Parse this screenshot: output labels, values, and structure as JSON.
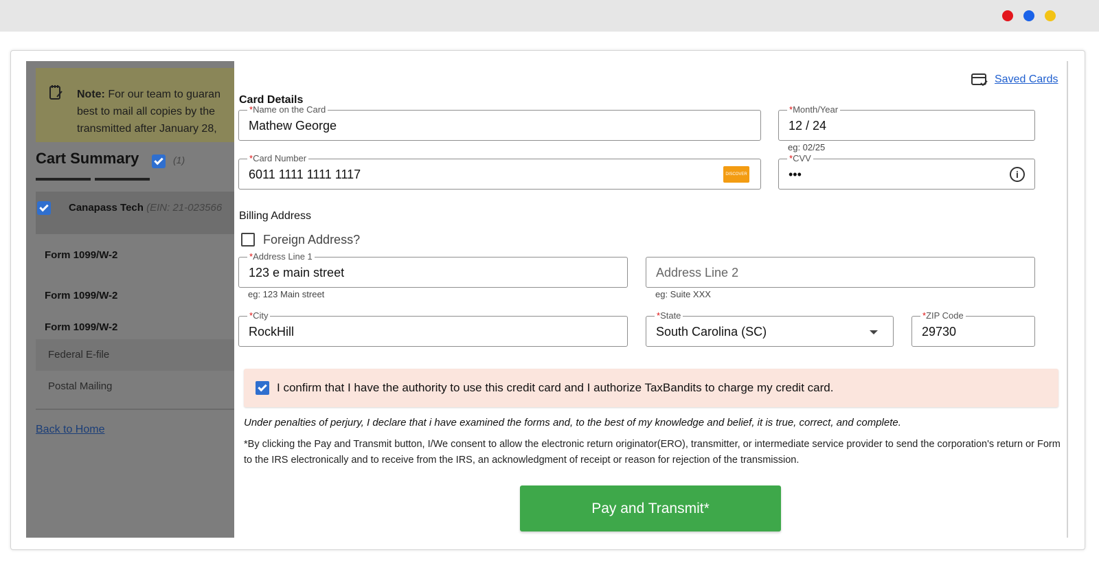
{
  "window": {
    "dots": [
      "#e3161d",
      "#1a62e8",
      "#f3c315"
    ]
  },
  "left": {
    "note": {
      "bold": "Note:",
      "line1": " For our team to guaran",
      "line2": "best to mail all copies by the ",
      "line3": "transmitted after January 28,"
    },
    "cart_title": "Cart Summary",
    "cart_count": "(1)",
    "company_name": "Canapass Tech",
    "company_ein": "(EIN:  21-023566",
    "forms": [
      "Form 1099/W-2",
      "Form 1099/W-2",
      "Form 1099/W-2"
    ],
    "services": [
      "Federal E-file",
      "Postal Mailing"
    ],
    "back_home": "Back to Home"
  },
  "payment": {
    "saved_cards": "Saved Cards",
    "card_details_title": "Card Details",
    "name_label": "Name on the Card",
    "name_value": "Mathew George",
    "month_label": "Month/Year",
    "month_value": "12 / 24",
    "month_hint": "eg: 02/25",
    "card_number_label": "Card Number",
    "card_number_value": "6011 1111 1111 1117",
    "card_brand": "DISCOVER",
    "cvv_label": "CVV",
    "cvv_value": "•••",
    "cvv_info": "i",
    "billing_title": "Billing Address",
    "foreign_label": "Foreign Address?",
    "address1_label": "Address Line 1",
    "address1_value": "123 e main street",
    "address1_hint": "eg: 123 Main street",
    "address2_placeholder": "Address Line 2",
    "address2_hint": "eg: Suite XXX",
    "city_label": "City",
    "city_value": "RockHill",
    "state_label": "State",
    "state_value": "South Carolina (SC)",
    "zip_label": "ZIP Code",
    "zip_value": "29730",
    "required_mark": "*",
    "confirm_text": "I confirm that I have the authority to use this credit card and I authorize TaxBandits to charge my credit card.",
    "penalty_text": "Under penalties of perjury, I declare that i have examined the forms and, to the best of my knowledge and belief, it is true, correct, and complete.",
    "consent_text": "*By clicking the Pay and Transmit button, I/We consent to allow the electronic return originator(ERO), transmitter, or intermediate service provider to send the corporation's return or Form to the IRS electronically and to receive from the IRS, an acknowledgment of receipt or reason for rejection of the transmission.",
    "pay_button": "Pay and Transmit*"
  }
}
